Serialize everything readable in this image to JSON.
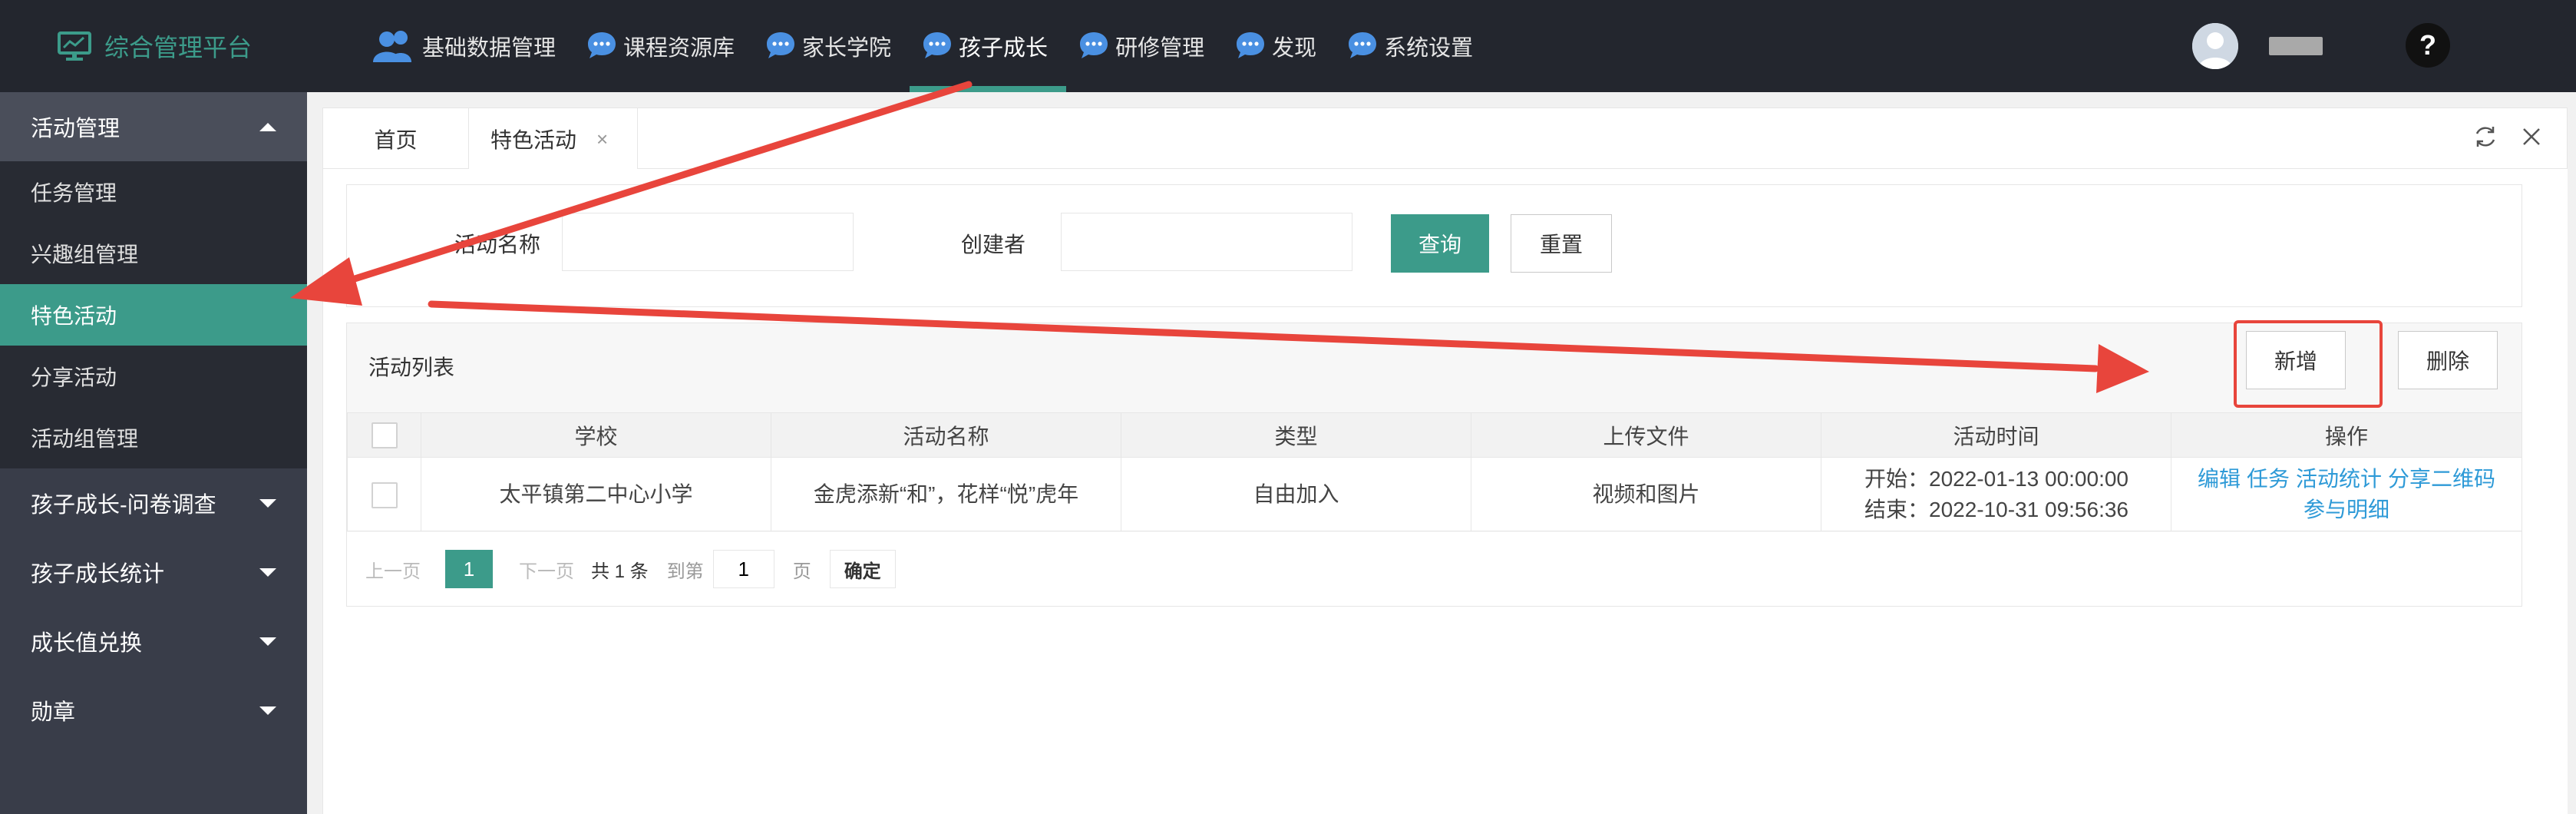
{
  "brand": {
    "title": "综合管理平台",
    "logo_icon": "dashboard-logo-icon"
  },
  "top_nav": [
    {
      "label": "基础数据管理",
      "icon": "users-icon",
      "active": false
    },
    {
      "label": "课程资源库",
      "icon": "chat-bubble-icon",
      "active": false
    },
    {
      "label": "家长学院",
      "icon": "chat-bubble-icon",
      "active": false
    },
    {
      "label": "孩子成长",
      "icon": "chat-bubble-icon",
      "active": true
    },
    {
      "label": "研修管理",
      "icon": "chat-bubble-icon",
      "active": false
    },
    {
      "label": "发现",
      "icon": "chat-bubble-icon",
      "active": false
    },
    {
      "label": "系统设置",
      "icon": "chat-bubble-icon",
      "active": false
    }
  ],
  "user": {
    "help_label": "?"
  },
  "sidebar": {
    "groups": [
      {
        "label": "活动管理",
        "open": true,
        "items": [
          {
            "label": "任务管理"
          },
          {
            "label": "兴趣组管理"
          },
          {
            "label": "特色活动",
            "active": true
          },
          {
            "label": "分享活动"
          },
          {
            "label": "活动组管理"
          }
        ]
      },
      {
        "label": "孩子成长-问卷调查",
        "open": false
      },
      {
        "label": "孩子成长统计",
        "open": false
      },
      {
        "label": "成长值兑换",
        "open": false
      },
      {
        "label": "勋章",
        "open": false
      }
    ]
  },
  "tabs": {
    "home": "首页",
    "active": "特色活动",
    "close": "×"
  },
  "search": {
    "name_label": "活动名称",
    "name_value": "",
    "name_placeholder": "",
    "creator_label": "创建者",
    "creator_value": "",
    "creator_placeholder": "",
    "query_button": "查询",
    "reset_button": "重置"
  },
  "list": {
    "title": "活动列表",
    "add_button": "新增",
    "delete_button": "删除",
    "columns": [
      "学校",
      "活动名称",
      "类型",
      "上传文件",
      "活动时间",
      "操作"
    ],
    "rows": [
      {
        "school": "太平镇第二中心小学",
        "name": "金虎添新“和”，花样“悦”虎年",
        "type": "自由加入",
        "files": "视频和图片",
        "start": "开始：2022-01-13 00:00:00",
        "end": "结束：2022-10-31 09:56:36",
        "ops": [
          "编辑",
          "任务",
          "活动统计",
          "分享二维码",
          "参与明细"
        ]
      }
    ]
  },
  "pager": {
    "prev": "上一页",
    "current": "1",
    "next": "下一页",
    "total": "共 1 条",
    "goto": "到第",
    "goto_value": "1",
    "page_unit": "页",
    "confirm": "确定"
  },
  "colors": {
    "accent": "#3c9b8a",
    "topbar": "#23262e",
    "sidebar": "#393d49",
    "annotation": "#e8453c",
    "link": "#2e9ad7"
  }
}
